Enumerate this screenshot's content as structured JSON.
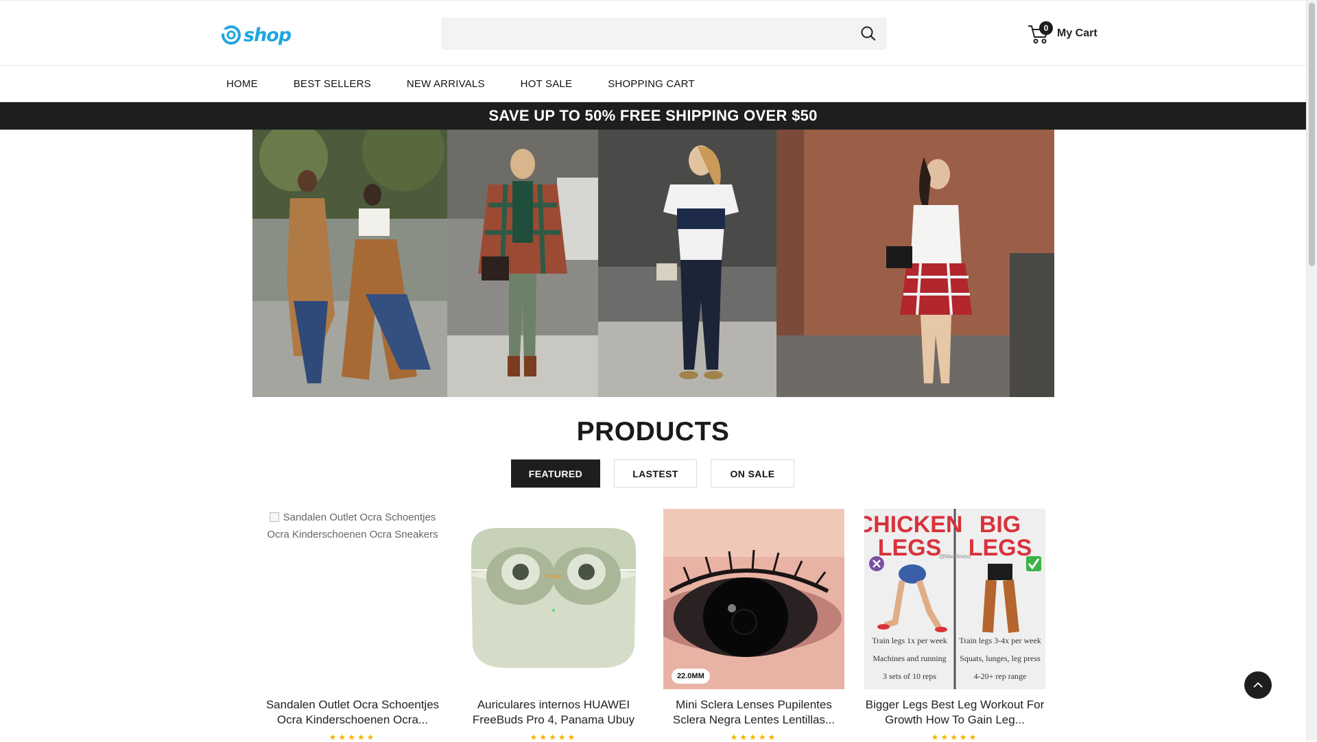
{
  "header": {
    "logo_text": "shop",
    "search": {
      "value": "",
      "placeholder": ""
    },
    "cart": {
      "count": "0",
      "label": "My Cart"
    }
  },
  "nav": {
    "items": [
      {
        "label": "HOME"
      },
      {
        "label": "BEST SELLERS"
      },
      {
        "label": "NEW ARRIVALS"
      },
      {
        "label": "HOT SALE"
      },
      {
        "label": "SHOPPING CART"
      }
    ]
  },
  "promo": {
    "text": "SAVE UP TO 50% FREE SHIPPING OVER $50"
  },
  "products": {
    "title": "PRODUCTS",
    "tabs": [
      {
        "label": "FEATURED",
        "active": true
      },
      {
        "label": "LASTEST",
        "active": false
      },
      {
        "label": "ON SALE",
        "active": false
      }
    ],
    "items": [
      {
        "title": "Sandalen Outlet Ocra Schoentjes Ocra Kinderschoenen Ocra...",
        "image_alt": "Sandalen Outlet Ocra Schoentjes Ocra Kinderschoenen Ocra Sneakers",
        "stars": "★★★★★"
      },
      {
        "title": "Auriculares internos HUAWEI FreeBuds Pro 4, Panama Ubuy",
        "stars": "★★★★★"
      },
      {
        "title": "Mini Sclera Lenses Pupilentes Sclera Negra Lentes Lentillas...",
        "badge": "22.0MM",
        "stars": "★★★★★"
      },
      {
        "title": "Bigger Legs Best Leg Workout For Growth How To Gain Leg...",
        "stars": "★★★★★",
        "poster": {
          "left_heading_1": "CHICKEN",
          "left_heading_2": "LEGS",
          "right_heading_1": "BIG",
          "right_heading_2": "LEGS",
          "watermark": "@Maxfitness",
          "left_lines": [
            "Train legs 1x per week",
            "Machines and running",
            "3 sets of 10 reps"
          ],
          "right_lines": [
            "Train legs 3-4x per week",
            "Squats, lunges, leg press",
            "4-20+ rep range"
          ]
        }
      }
    ]
  },
  "colors": {
    "accent": "#1fa6e0",
    "dark": "#1e1e1e",
    "star": "#f5b200",
    "poster_red": "#d9323b"
  }
}
